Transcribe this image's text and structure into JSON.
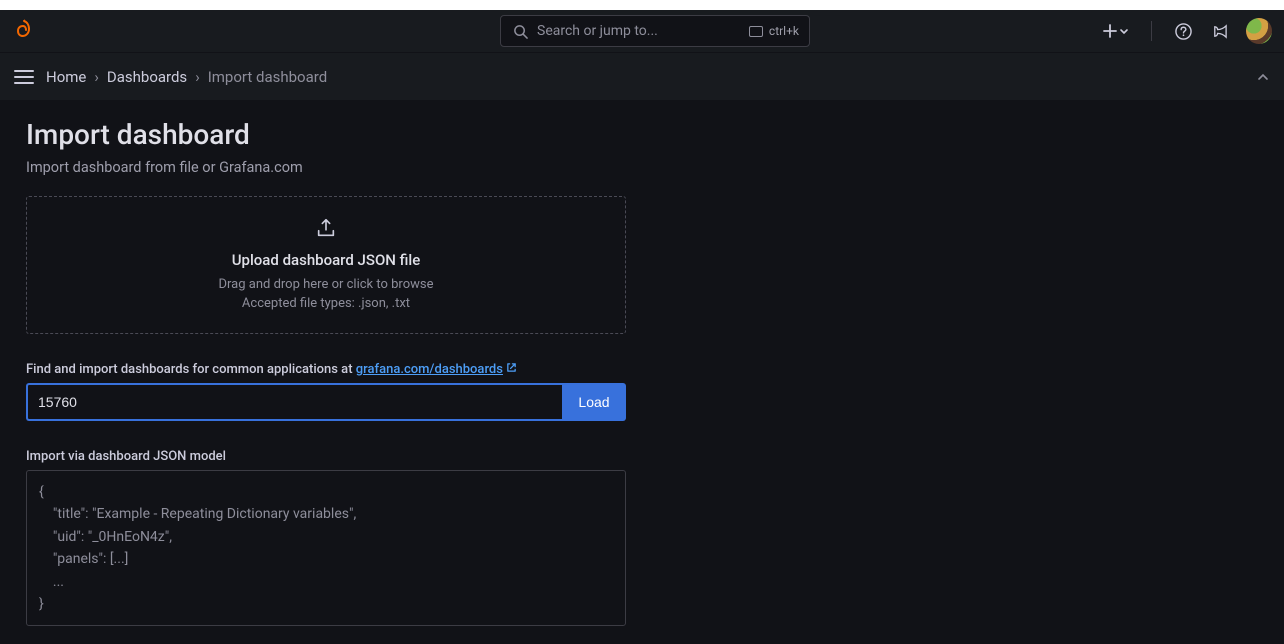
{
  "header": {
    "search_placeholder": "Search or jump to...",
    "shortcut": "ctrl+k"
  },
  "breadcrumbs": {
    "home": "Home",
    "dashboards": "Dashboards",
    "current": "Import dashboard"
  },
  "page": {
    "title": "Import dashboard",
    "subtitle": "Import dashboard from file or Grafana.com"
  },
  "dropzone": {
    "title": "Upload dashboard JSON file",
    "hint1": "Drag and drop here or click to browse",
    "hint2": "Accepted file types: .json, .txt"
  },
  "find": {
    "label_prefix": "Find and import dashboards for common applications at ",
    "link_text": "grafana.com/dashboards",
    "input_value": "15760",
    "load_label": "Load"
  },
  "json": {
    "label": "Import via dashboard JSON model",
    "placeholder": "{\n    \"title\": \"Example - Repeating Dictionary variables\",\n    \"uid\": \"_0HnEoN4z\",\n    \"panels\": [...]\n    ...\n}"
  }
}
